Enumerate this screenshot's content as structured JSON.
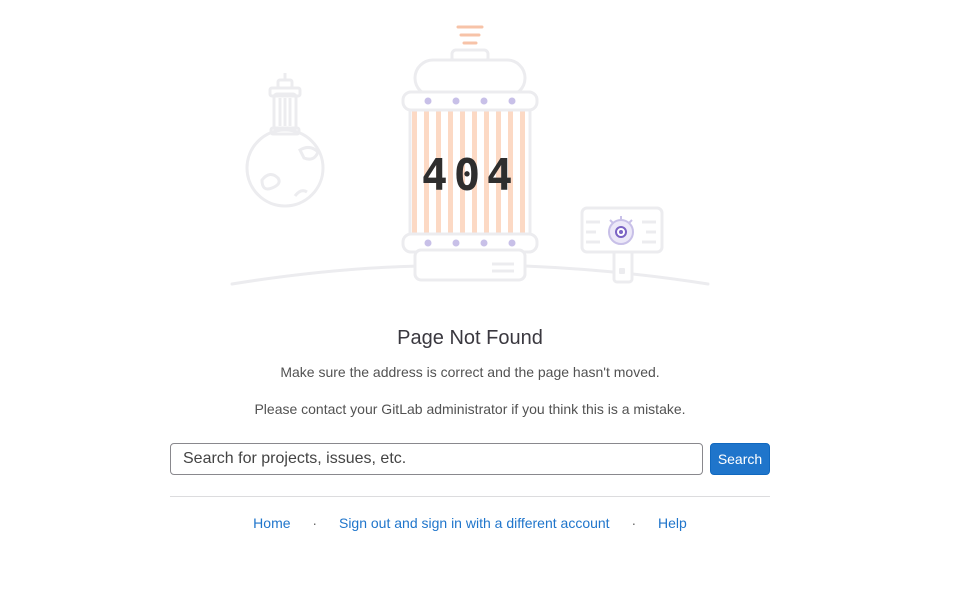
{
  "illustration": {
    "code_text": "404",
    "colors": {
      "line": "#ececef",
      "stripe": "#fcd9c4",
      "dot": "#c8c0e8",
      "eye": "#7b63c4",
      "signal": "#f7c3a8"
    }
  },
  "main": {
    "title": "Page Not Found",
    "message_1": "Make sure the address is correct and the page hasn't moved.",
    "message_2": "Please contact your GitLab administrator if you think this is a mistake."
  },
  "search": {
    "placeholder": "Search for projects, issues, etc.",
    "value": "",
    "button_label": "Search"
  },
  "footer": {
    "home_label": "Home",
    "separator": "·",
    "signout_label": "Sign out and sign in with a different account",
    "help_label": "Help"
  },
  "colors": {
    "accent": "#1f75cb",
    "title_text": "#3a383f",
    "body_text": "#525252"
  }
}
